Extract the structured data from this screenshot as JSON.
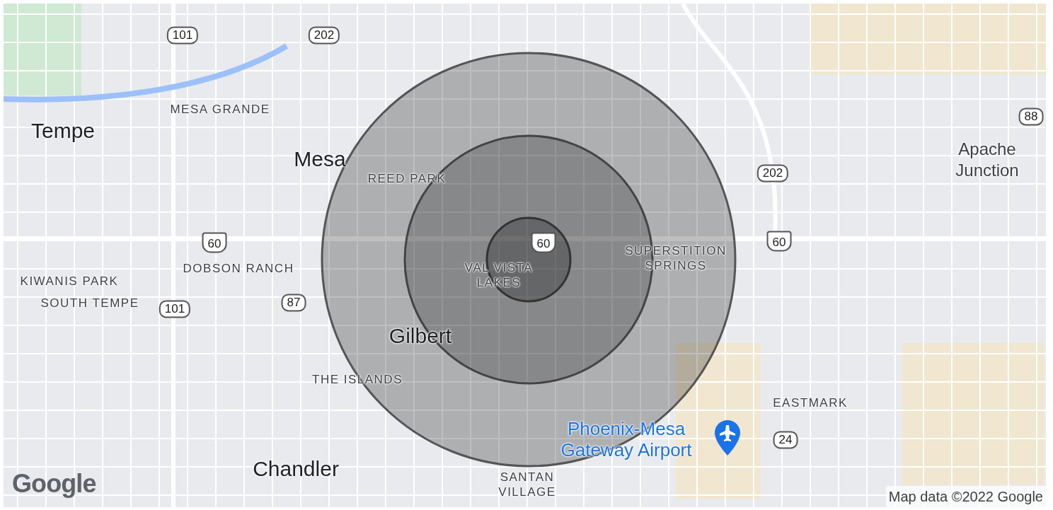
{
  "map": {
    "labels": [
      {
        "kind": "highway",
        "text": "101"
      },
      {
        "kind": "highway",
        "text": "202"
      },
      {
        "kind": "area",
        "text": "MESA GRANDE"
      },
      {
        "kind": "city",
        "text": "Tempe"
      },
      {
        "kind": "city",
        "text": "Mesa"
      },
      {
        "kind": "area",
        "text": "REED PARK"
      },
      {
        "kind": "highway",
        "text": "88"
      },
      {
        "kind": "highway",
        "text": "202"
      },
      {
        "kind": "town",
        "text": "Apache Junction"
      },
      {
        "kind": "shield",
        "text": "60"
      },
      {
        "kind": "shield",
        "text": "60"
      },
      {
        "kind": "shield",
        "text": "60"
      },
      {
        "kind": "area",
        "text": "SUPERSTITION SPRINGS"
      },
      {
        "kind": "area",
        "text": "KIWANIS PARK"
      },
      {
        "kind": "area",
        "text": "DOBSON RANCH"
      },
      {
        "kind": "area",
        "text": "VAL VISTA LAKES"
      },
      {
        "kind": "area",
        "text": "SOUTH TEMPE"
      },
      {
        "kind": "highway",
        "text": "101"
      },
      {
        "kind": "highway",
        "text": "87"
      },
      {
        "kind": "city",
        "text": "Gilbert"
      },
      {
        "kind": "area",
        "text": "THE ISLANDS"
      },
      {
        "kind": "area",
        "text": "EASTMARK"
      },
      {
        "kind": "airport",
        "text": "Phoenix-Mesa Gateway Airport"
      },
      {
        "kind": "highway",
        "text": "24"
      },
      {
        "kind": "city",
        "text": "Chandler"
      },
      {
        "kind": "area",
        "text": "SANTAN VILLAGE"
      }
    ],
    "logo": "Google",
    "attribution": "Map data ©2022 Google"
  }
}
